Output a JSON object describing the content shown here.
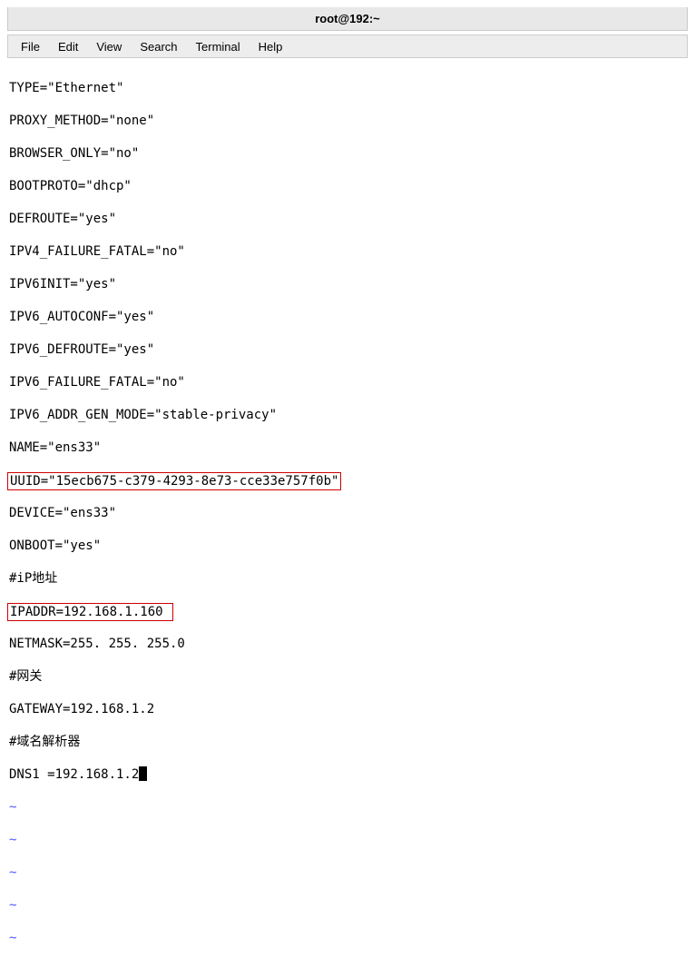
{
  "titlebar": {
    "title": "root@192:~"
  },
  "menubar": {
    "file": "File",
    "edit": "Edit",
    "view": "View",
    "search": "Search",
    "terminal": "Terminal",
    "help": "Help"
  },
  "content": {
    "line01": "TYPE=\"Ethernet\"",
    "line02": "PROXY_METHOD=\"none\"",
    "line03": "BROWSER_ONLY=\"no\"",
    "line04": "BOOTPROTO=\"dhcp\"",
    "line05": "DEFROUTE=\"yes\"",
    "line06": "IPV4_FAILURE_FATAL=\"no\"",
    "line07": "IPV6INIT=\"yes\"",
    "line08": "IPV6_AUTOCONF=\"yes\"",
    "line09": "IPV6_DEFROUTE=\"yes\"",
    "line10": "IPV6_FAILURE_FATAL=\"no\"",
    "line11": "IPV6_ADDR_GEN_MODE=\"stable-privacy\"",
    "line12": "NAME=\"ens33\"",
    "line13": "UUID=\"15ecb675-c379-4293-8e73-cce33e757f0b\"",
    "line14": "DEVICE=\"ens33\"",
    "line15": "ONBOOT=\"yes\"",
    "line16": "#iP地址",
    "line17": "IPADDR=192.168.1.160 ",
    "line18": "NETMASK=255. 255. 255.0",
    "line19": "#网关",
    "line20": "GATEWAY=192.168.1.2",
    "line21": "#域名解析器",
    "line22": "DNS1 =192.168.1.2",
    "tilde": "~"
  }
}
